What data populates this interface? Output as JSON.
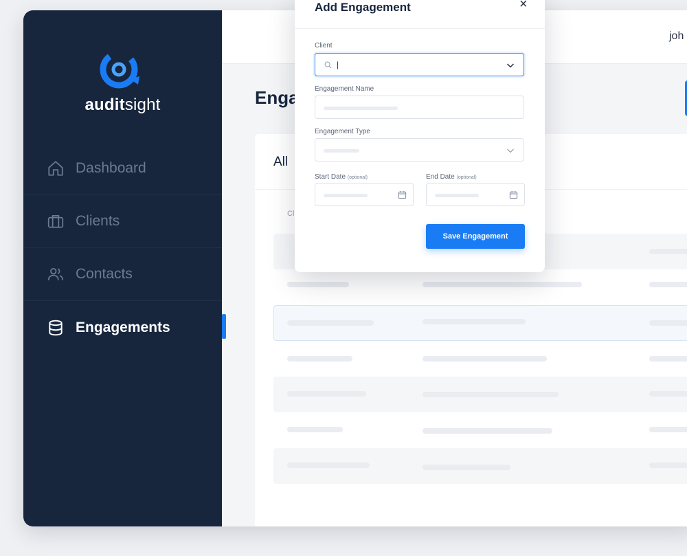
{
  "brand": {
    "name_bold": "audit",
    "name_light": "sight",
    "accent": "#1a7cf5",
    "sidebar_bg": "#17263d"
  },
  "sidebar": {
    "items": [
      {
        "label": "Dashboard",
        "icon": "home-icon"
      },
      {
        "label": "Clients",
        "icon": "briefcase-icon"
      },
      {
        "label": "Contacts",
        "icon": "users-icon"
      },
      {
        "label": "Engagements",
        "icon": "database-icon",
        "active": true
      }
    ]
  },
  "topbar": {
    "user_name": "joh"
  },
  "page": {
    "title": "Enga",
    "tab_label": "All",
    "column_hint": "Cl"
  },
  "modal": {
    "title": "Add Engagement",
    "close_symbol": "×",
    "fields": {
      "client": {
        "label": "Client",
        "value": "|"
      },
      "engagement_name": {
        "label": "Engagement Name"
      },
      "engagement_type": {
        "label": "Engagement Type"
      },
      "start_date": {
        "label": "Start Date",
        "optional": "(optional)"
      },
      "end_date": {
        "label": "End Date",
        "optional": "(optional)"
      }
    },
    "save_label": "Save Engagement"
  }
}
